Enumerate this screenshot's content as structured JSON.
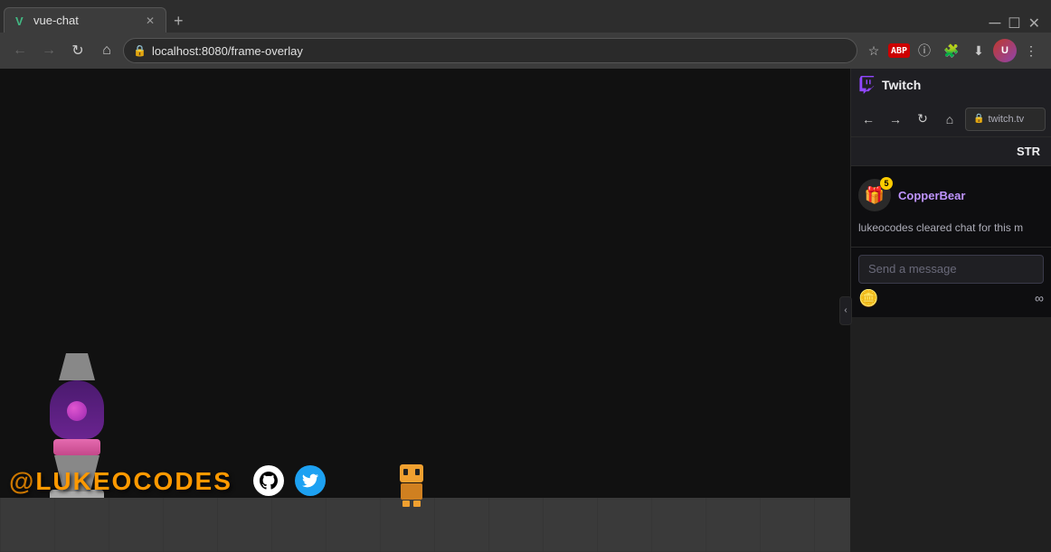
{
  "browser": {
    "tab_title": "vue-chat",
    "tab_favicon": "V",
    "address": "localhost:8080/frame-overlay",
    "new_tab_btn": "+",
    "nav": {
      "back": "←",
      "forward": "→",
      "refresh": "↻",
      "home": "⌂"
    }
  },
  "twitch": {
    "title": "Twitch",
    "address": "twitch.tv",
    "str_label": "STR",
    "gift_user": "CopperBear",
    "gift_count": "5",
    "gift_icon": "🎁",
    "system_message": "lukeocodes cleared chat for this m",
    "chat_placeholder": "Send a message",
    "collapse_icon": "‹"
  },
  "game": {
    "overlay_at": "@",
    "overlay_name": "LUKEOCODES",
    "social_github": "⊙",
    "social_twitter": "🐦",
    "character_color": "#f0a030"
  }
}
